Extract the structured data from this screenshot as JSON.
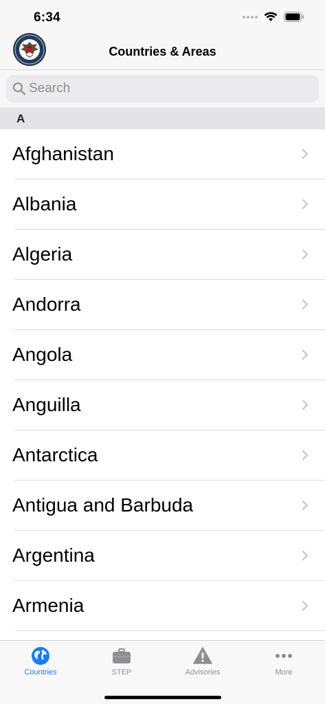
{
  "status_bar": {
    "time": "6:34"
  },
  "nav": {
    "title": "Countries & Areas",
    "logo_icon": "state-department-seal-icon"
  },
  "search": {
    "placeholder": "Search",
    "value": ""
  },
  "section": {
    "letter": "A"
  },
  "countries": [
    {
      "name": "Afghanistan"
    },
    {
      "name": "Albania"
    },
    {
      "name": "Algeria"
    },
    {
      "name": "Andorra"
    },
    {
      "name": "Angola"
    },
    {
      "name": "Anguilla"
    },
    {
      "name": "Antarctica"
    },
    {
      "name": "Antigua and Barbuda"
    },
    {
      "name": "Argentina"
    },
    {
      "name": "Armenia"
    }
  ],
  "tabs": [
    {
      "label": "Countries",
      "icon": "globe-icon",
      "active": true
    },
    {
      "label": "STEP",
      "icon": "briefcase-icon",
      "active": false
    },
    {
      "label": "Advisories",
      "icon": "warning-icon",
      "active": false
    },
    {
      "label": "More",
      "icon": "more-dots-icon",
      "active": false
    }
  ],
  "colors": {
    "accent": "#1a7cf5",
    "inactive_tab": "#8e8e93",
    "chevron": "#c4c4c7",
    "section_header_bg": "#e4e4e6"
  }
}
